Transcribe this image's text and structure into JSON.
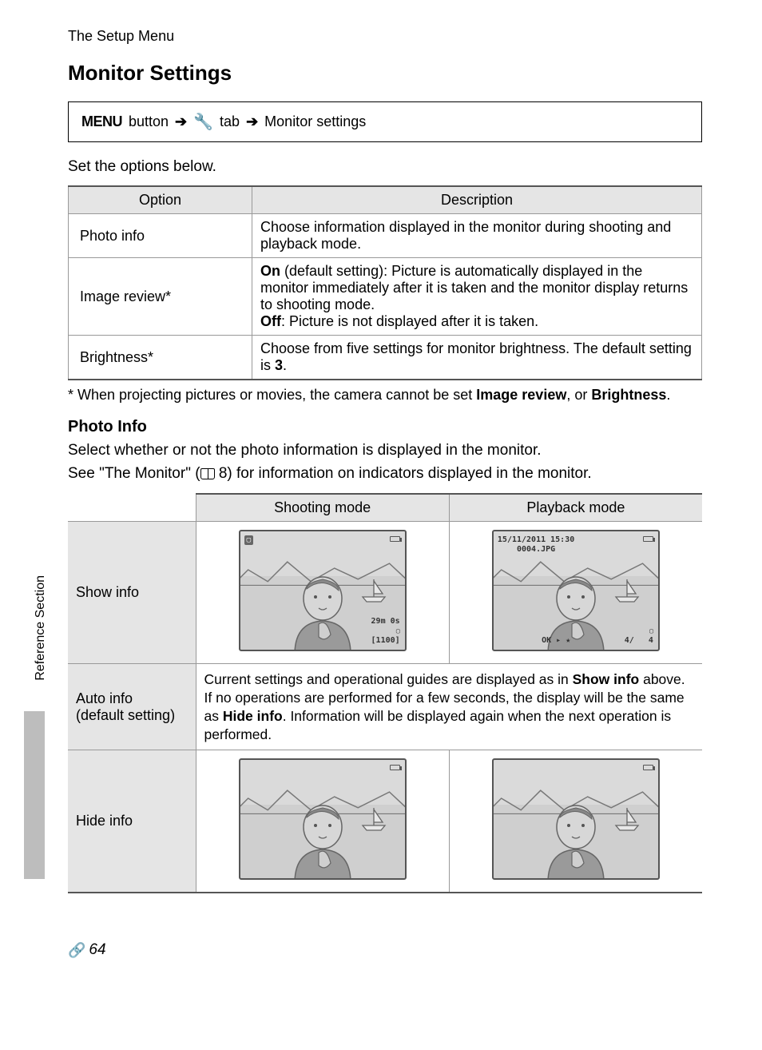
{
  "section_header": "The Setup Menu",
  "title": "Monitor Settings",
  "nav": {
    "menu_label": "MENU",
    "menu_suffix": "button",
    "tab_suffix": "tab",
    "destination": "Monitor settings"
  },
  "intro": "Set the options below.",
  "options_table": {
    "headers": {
      "option": "Option",
      "description": "Description"
    },
    "rows": [
      {
        "option": "Photo info",
        "description": "Choose information displayed in the monitor during shooting and playback mode."
      },
      {
        "option": "Image review*",
        "description_html": "<b>On</b> (default setting): Picture is automatically displayed in the monitor immediately after it is taken and the monitor display returns to shooting mode.<br><b>Off</b>: Picture is not displayed after it is taken."
      },
      {
        "option": "Brightness*",
        "description_html": "Choose from five settings for monitor brightness. The default setting is <b>3</b>."
      }
    ]
  },
  "footnote_html": "* When projecting pictures or movies, the camera cannot be set <b>Image review</b>, or <b>Brightness</b>.",
  "photo_info_section": {
    "heading": "Photo Info",
    "para1": "Select whether or not the photo information is displayed in the monitor.",
    "para2_pre": "See \"The Monitor\" (",
    "para2_ref": " 8",
    "para2_post": ") for information on indicators displayed in the monitor."
  },
  "photo_info_table": {
    "headers": {
      "shooting": "Shooting mode",
      "playback": "Playback mode"
    },
    "rows": {
      "show_info": "Show info",
      "auto_info_line1": "Auto info",
      "auto_info_line2": "(default setting)",
      "auto_info_desc_html": "Current settings and operational guides are displayed as in <b>Show info</b> above. If no operations are performed for a few seconds, the display will be the same as <b>Hide info</b>. Information will be displayed again when the next operation is performed.",
      "hide_info": "Hide info"
    }
  },
  "thumbs": {
    "show_shoot": {
      "br_line1": "29m 0s",
      "br_line2": "[1100]",
      "tl_badge": "▢"
    },
    "show_play": {
      "tl_line1": "15/11/2011 15:30",
      "tl_line2": "0004.JPG",
      "br": "4/   4",
      "bc": "OK ▸ ★"
    }
  },
  "side_label": "Reference Section",
  "page_number": "64"
}
